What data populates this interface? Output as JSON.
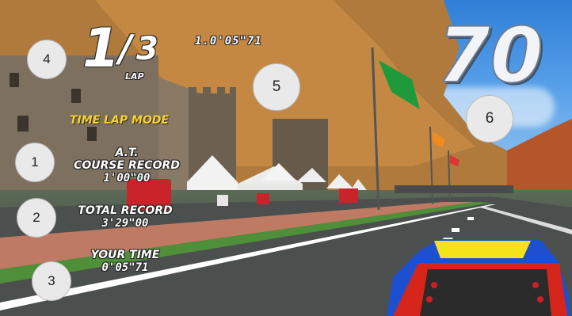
{
  "hud": {
    "lap_current": "1",
    "lap_separator": "/",
    "lap_total": "3",
    "lap_label": "LAP",
    "total_time": "1.0'05\"71",
    "speed": "70",
    "mode": "TIME LAP MODE",
    "at_label": "A.T.",
    "course_record_label": "COURSE RECORD",
    "course_record_value": "1'00\"00",
    "total_record_label": "TOTAL RECORD",
    "total_record_value": "3'29\"00",
    "your_time_label": "YOUR TIME",
    "your_time_value": "0'05\"71"
  },
  "markers": [
    "1",
    "2",
    "3",
    "4",
    "5",
    "6"
  ],
  "colors": {
    "mode_text": "#f4d23a",
    "car_blue": "#1e4fd0",
    "car_yellow": "#f5e21a",
    "car_red": "#d6261b",
    "flag_green": "#1f9a3a"
  }
}
